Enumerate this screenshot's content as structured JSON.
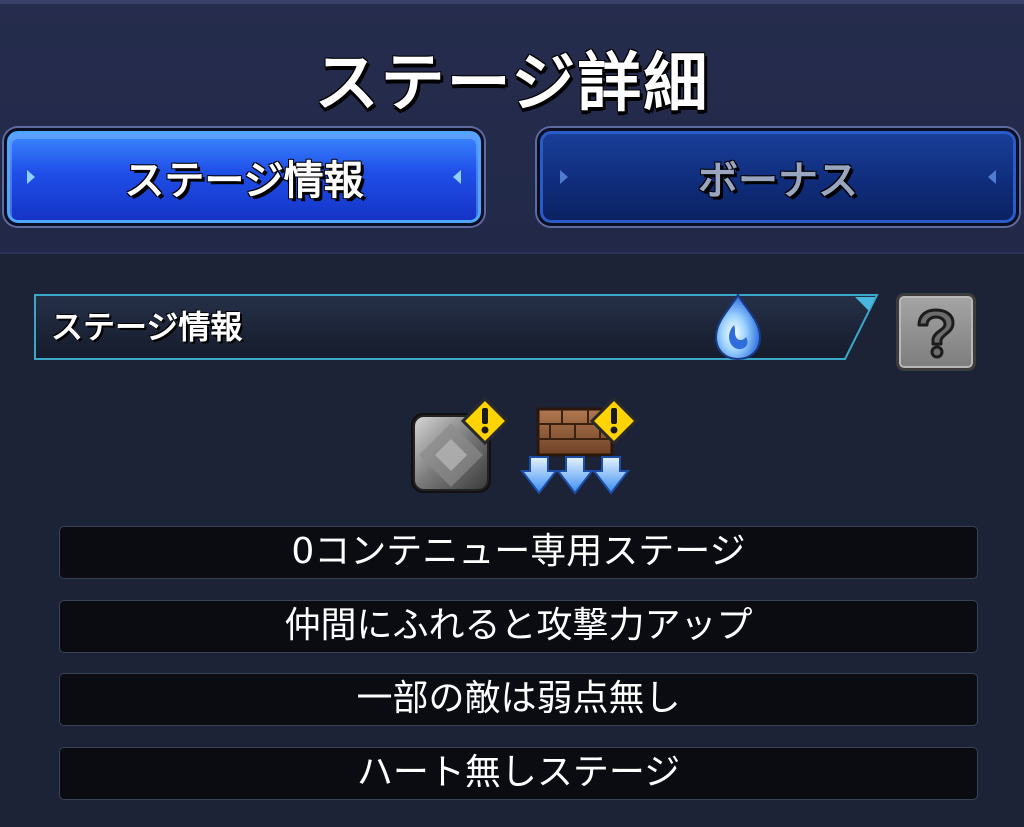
{
  "screen": {
    "title": "ステージ詳細"
  },
  "tabs": [
    {
      "label": "ステージ情報",
      "active": true
    },
    {
      "label": "ボーナス",
      "active": false
    }
  ],
  "info_section": {
    "header_label": "ステージ情報",
    "element_icon": "water-element-icon",
    "help_icon": "help-question-icon",
    "gimmicks": [
      {
        "icon": "block-gimmick-icon",
        "warning_icon": "warning-icon"
      },
      {
        "icon": "damage-wall-gimmick-icon",
        "warning_icon": "warning-icon"
      }
    ]
  },
  "rules": [
    "0コンテニュー専用ステージ",
    "仲間にふれると攻撃力アップ",
    "一部の敵は弱点無し",
    "ハート無しステージ"
  ],
  "colors": {
    "tab_active": "#1f4fe8",
    "tab_inactive": "#0f2d7c",
    "warning": "#ffd400",
    "background": "#1d2337"
  }
}
